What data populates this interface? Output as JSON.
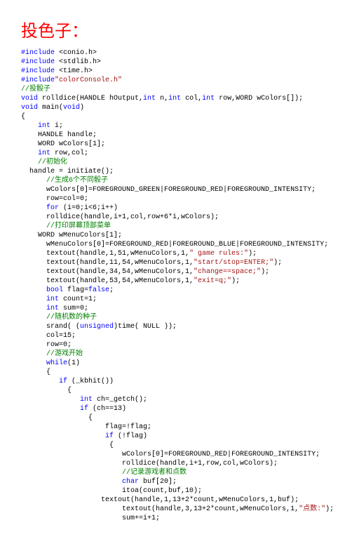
{
  "title": "投色子：",
  "lines": [
    [
      {
        "t": "#include",
        "c": "pp"
      },
      {
        "t": " <conio.h>",
        "c": "nm"
      }
    ],
    [
      {
        "t": "#include",
        "c": "pp"
      },
      {
        "t": " <stdlib.h>",
        "c": "nm"
      }
    ],
    [
      {
        "t": "#include",
        "c": "pp"
      },
      {
        "t": " <time.h>",
        "c": "nm"
      }
    ],
    [
      {
        "t": "#include",
        "c": "pp"
      },
      {
        "t": "\"colorConsole.h\"",
        "c": "st"
      }
    ],
    [
      {
        "t": "//投骰子",
        "c": "cm"
      }
    ],
    [
      {
        "t": "void",
        "c": "kw"
      },
      {
        "t": " rolldice(HANDLE hOutput,",
        "c": "nm"
      },
      {
        "t": "int",
        "c": "kw"
      },
      {
        "t": " n,",
        "c": "nm"
      },
      {
        "t": "int",
        "c": "kw"
      },
      {
        "t": " col,",
        "c": "nm"
      },
      {
        "t": "int",
        "c": "kw"
      },
      {
        "t": " row,WORD wColors[]);",
        "c": "nm"
      }
    ],
    [
      {
        "t": "void",
        "c": "kw"
      },
      {
        "t": " main(",
        "c": "nm"
      },
      {
        "t": "void",
        "c": "kw"
      },
      {
        "t": ")",
        "c": "nm"
      }
    ],
    [
      {
        "t": "{",
        "c": "nm"
      }
    ],
    [
      {
        "t": "    ",
        "c": "nm"
      },
      {
        "t": "int",
        "c": "kw"
      },
      {
        "t": " i;",
        "c": "nm"
      }
    ],
    [
      {
        "t": "    HANDLE handle;",
        "c": "nm"
      }
    ],
    [
      {
        "t": "    WORD wColors[1];",
        "c": "nm"
      }
    ],
    [
      {
        "t": "    ",
        "c": "nm"
      },
      {
        "t": "int",
        "c": "kw"
      },
      {
        "t": " row,col;",
        "c": "nm"
      }
    ],
    [
      {
        "t": "    ",
        "c": "nm"
      },
      {
        "t": "//初始化",
        "c": "cm"
      }
    ],
    [
      {
        "t": "  handle = initiate();",
        "c": "nm"
      }
    ],
    [
      {
        "t": "      ",
        "c": "nm"
      },
      {
        "t": "//生成6个不同骰子",
        "c": "cm"
      }
    ],
    [
      {
        "t": "      wColors[0]=FOREGROUND_GREEN|FOREGROUND_RED|FOREGROUND_INTENSITY;",
        "c": "nm"
      }
    ],
    [
      {
        "t": "      row=col=0;",
        "c": "nm"
      }
    ],
    [
      {
        "t": "      ",
        "c": "nm"
      },
      {
        "t": "for",
        "c": "kw"
      },
      {
        "t": " (i=0;i<6;i++)",
        "c": "nm"
      }
    ],
    [
      {
        "t": "      rolldice(handle,i+1,col,row+6*i,wColors);",
        "c": "nm"
      }
    ],
    [
      {
        "t": "      ",
        "c": "nm"
      },
      {
        "t": "//打印屏幕顶部菜单",
        "c": "cm"
      }
    ],
    [
      {
        "t": "    WORD wMenuColors[1];",
        "c": "nm"
      }
    ],
    [
      {
        "t": "      wMenuColors[0]=FOREGROUND_RED|FOREGROUND_BLUE|FOREGROUND_INTENSITY;",
        "c": "nm"
      }
    ],
    [
      {
        "t": "      textout(handle,1,51,wMenuColors,1,",
        "c": "nm"
      },
      {
        "t": "\" game rules:\"",
        "c": "st"
      },
      {
        "t": ");",
        "c": "nm"
      }
    ],
    [
      {
        "t": "      textout(handle,11,54,wMenuColors,1,",
        "c": "nm"
      },
      {
        "t": "\"start/stop=ENTER;\"",
        "c": "st"
      },
      {
        "t": ");",
        "c": "nm"
      }
    ],
    [
      {
        "t": "      textout(handle,34,54,wMenuColors,1,",
        "c": "nm"
      },
      {
        "t": "\"change==space;\"",
        "c": "st"
      },
      {
        "t": ");",
        "c": "nm"
      }
    ],
    [
      {
        "t": "      textout(handle,53,54,wMenuColors,1,",
        "c": "nm"
      },
      {
        "t": "\"exit=q;\"",
        "c": "st"
      },
      {
        "t": ");",
        "c": "nm"
      }
    ],
    [
      {
        "t": "      ",
        "c": "nm"
      },
      {
        "t": "bool",
        "c": "kw"
      },
      {
        "t": " flag=",
        "c": "nm"
      },
      {
        "t": "false",
        "c": "kw"
      },
      {
        "t": ";",
        "c": "nm"
      }
    ],
    [
      {
        "t": "      ",
        "c": "nm"
      },
      {
        "t": "int",
        "c": "kw"
      },
      {
        "t": " count=1;",
        "c": "nm"
      }
    ],
    [
      {
        "t": "      ",
        "c": "nm"
      },
      {
        "t": "int",
        "c": "kw"
      },
      {
        "t": " sum=0;",
        "c": "nm"
      }
    ],
    [
      {
        "t": "      ",
        "c": "nm"
      },
      {
        "t": "//随机数的种子",
        "c": "cm"
      }
    ],
    [
      {
        "t": "      srand( (",
        "c": "nm"
      },
      {
        "t": "unsigned",
        "c": "kw"
      },
      {
        "t": ")time( NULL ));",
        "c": "nm"
      }
    ],
    [
      {
        "t": "      col=15;",
        "c": "nm"
      }
    ],
    [
      {
        "t": "      row=0;",
        "c": "nm"
      }
    ],
    [
      {
        "t": "      ",
        "c": "nm"
      },
      {
        "t": "//游戏开始",
        "c": "cm"
      }
    ],
    [
      {
        "t": "      ",
        "c": "nm"
      },
      {
        "t": "while",
        "c": "kw"
      },
      {
        "t": "(1)",
        "c": "nm"
      }
    ],
    [
      {
        "t": "      {",
        "c": "nm"
      }
    ],
    [
      {
        "t": "         ",
        "c": "nm"
      },
      {
        "t": "if",
        "c": "kw"
      },
      {
        "t": " (_kbhit())",
        "c": "nm"
      }
    ],
    [
      {
        "t": "           {",
        "c": "nm"
      }
    ],
    [
      {
        "t": "              ",
        "c": "nm"
      },
      {
        "t": "int",
        "c": "kw"
      },
      {
        "t": " ch=_getch();",
        "c": "nm"
      }
    ],
    [
      {
        "t": "              ",
        "c": "nm"
      },
      {
        "t": "if",
        "c": "kw"
      },
      {
        "t": " (ch==13)",
        "c": "nm"
      }
    ],
    [
      {
        "t": "                {",
        "c": "nm"
      }
    ],
    [
      {
        "t": "                    flag=!flag;",
        "c": "nm"
      }
    ],
    [
      {
        "t": "                    ",
        "c": "nm"
      },
      {
        "t": "if",
        "c": "kw"
      },
      {
        "t": " (!flag)",
        "c": "nm"
      }
    ],
    [
      {
        "t": "                     {",
        "c": "nm"
      }
    ],
    [
      {
        "t": "                        wColors[0]=FOREGROUND_RED|FOREGROUND_INTENSITY;",
        "c": "nm"
      }
    ],
    [
      {
        "t": "                        rolldice(handle,i+1,row,col,wColors);",
        "c": "nm"
      }
    ],
    [
      {
        "t": "                        ",
        "c": "nm"
      },
      {
        "t": "//记录游戏者和点数",
        "c": "cm"
      }
    ],
    [
      {
        "t": "                        ",
        "c": "nm"
      },
      {
        "t": "char",
        "c": "kw"
      },
      {
        "t": " buf[20];",
        "c": "nm"
      }
    ],
    [
      {
        "t": "                        itoa(count,buf,10);",
        "c": "nm"
      }
    ],
    [
      {
        "t": "                   textout(handle,1,13+2*count,wMenuColors,1,buf);",
        "c": "nm"
      }
    ],
    [
      {
        "t": "                        textout(handle,3,13+2*count,wMenuColors,1,",
        "c": "nm"
      },
      {
        "t": "\"点数:\"",
        "c": "st"
      },
      {
        "t": ");",
        "c": "nm"
      }
    ],
    [
      {
        "t": "                        sum+=i+1;",
        "c": "nm"
      }
    ]
  ]
}
